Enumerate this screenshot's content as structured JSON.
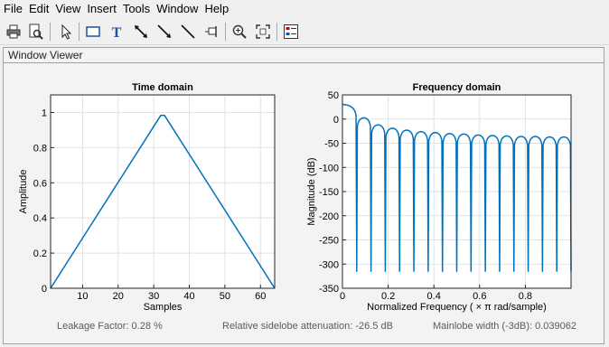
{
  "menu": [
    "File",
    "Edit",
    "View",
    "Insert",
    "Tools",
    "Window",
    "Help"
  ],
  "toolbar": {
    "buttons": [
      {
        "name": "print-icon"
      },
      {
        "name": "print-preview-icon"
      },
      {
        "name": "select-arrow-icon"
      },
      {
        "name": "insert-rectangle-icon"
      },
      {
        "name": "insert-text-icon"
      },
      {
        "name": "insert-double-arrow-icon"
      },
      {
        "name": "insert-arrow-icon"
      },
      {
        "name": "insert-line-icon"
      },
      {
        "name": "data-cursor-icon"
      },
      {
        "name": "zoom-in-icon"
      },
      {
        "name": "full-view-icon"
      },
      {
        "name": "legend-icon"
      }
    ]
  },
  "panel": {
    "title": "Window Viewer"
  },
  "colors": {
    "line": "#0072bd",
    "grid": "#e2e2e2"
  },
  "chart_data": [
    {
      "type": "line",
      "title": "Time domain",
      "xlabel": "Samples",
      "ylabel": "Amplitude",
      "xlim": [
        1,
        64
      ],
      "ylim": [
        0,
        1.1
      ],
      "xticks": [
        10,
        20,
        30,
        40,
        50,
        60
      ],
      "yticks": [
        0,
        0.2,
        0.4,
        0.6,
        0.8,
        1
      ],
      "x": [
        1,
        32,
        33,
        64
      ],
      "y": [
        0.0,
        0.984,
        0.984,
        0.0
      ],
      "grid": true
    },
    {
      "type": "line",
      "title": "Frequency domain",
      "xlabel": "Normalized  Frequency    ( × π  rad/sample)",
      "ylabel": "Magnitude (dB)",
      "xlim": [
        0,
        1
      ],
      "ylim": [
        -350,
        50
      ],
      "xticks": [
        0,
        0.2,
        0.4,
        0.6,
        0.8
      ],
      "yticks": [
        50,
        0,
        -50,
        -100,
        -150,
        -200,
        -250,
        -300,
        -350
      ],
      "mainlobe_peak_db": 30.1,
      "sidelobe_levels_db": [
        2.5,
        -12,
        -19,
        -23,
        -26,
        -28,
        -30,
        -31,
        -33,
        -34,
        -35,
        -36,
        -36,
        -37,
        -37
      ],
      "null_floor_db": -315,
      "grid": true
    }
  ],
  "stats": {
    "leakage": "Leakage Factor: 0.28 %",
    "sidelobe": "Relative sidelobe attenuation: -26.5 dB",
    "mainlobe": "Mainlobe width (-3dB): 0.039062"
  }
}
